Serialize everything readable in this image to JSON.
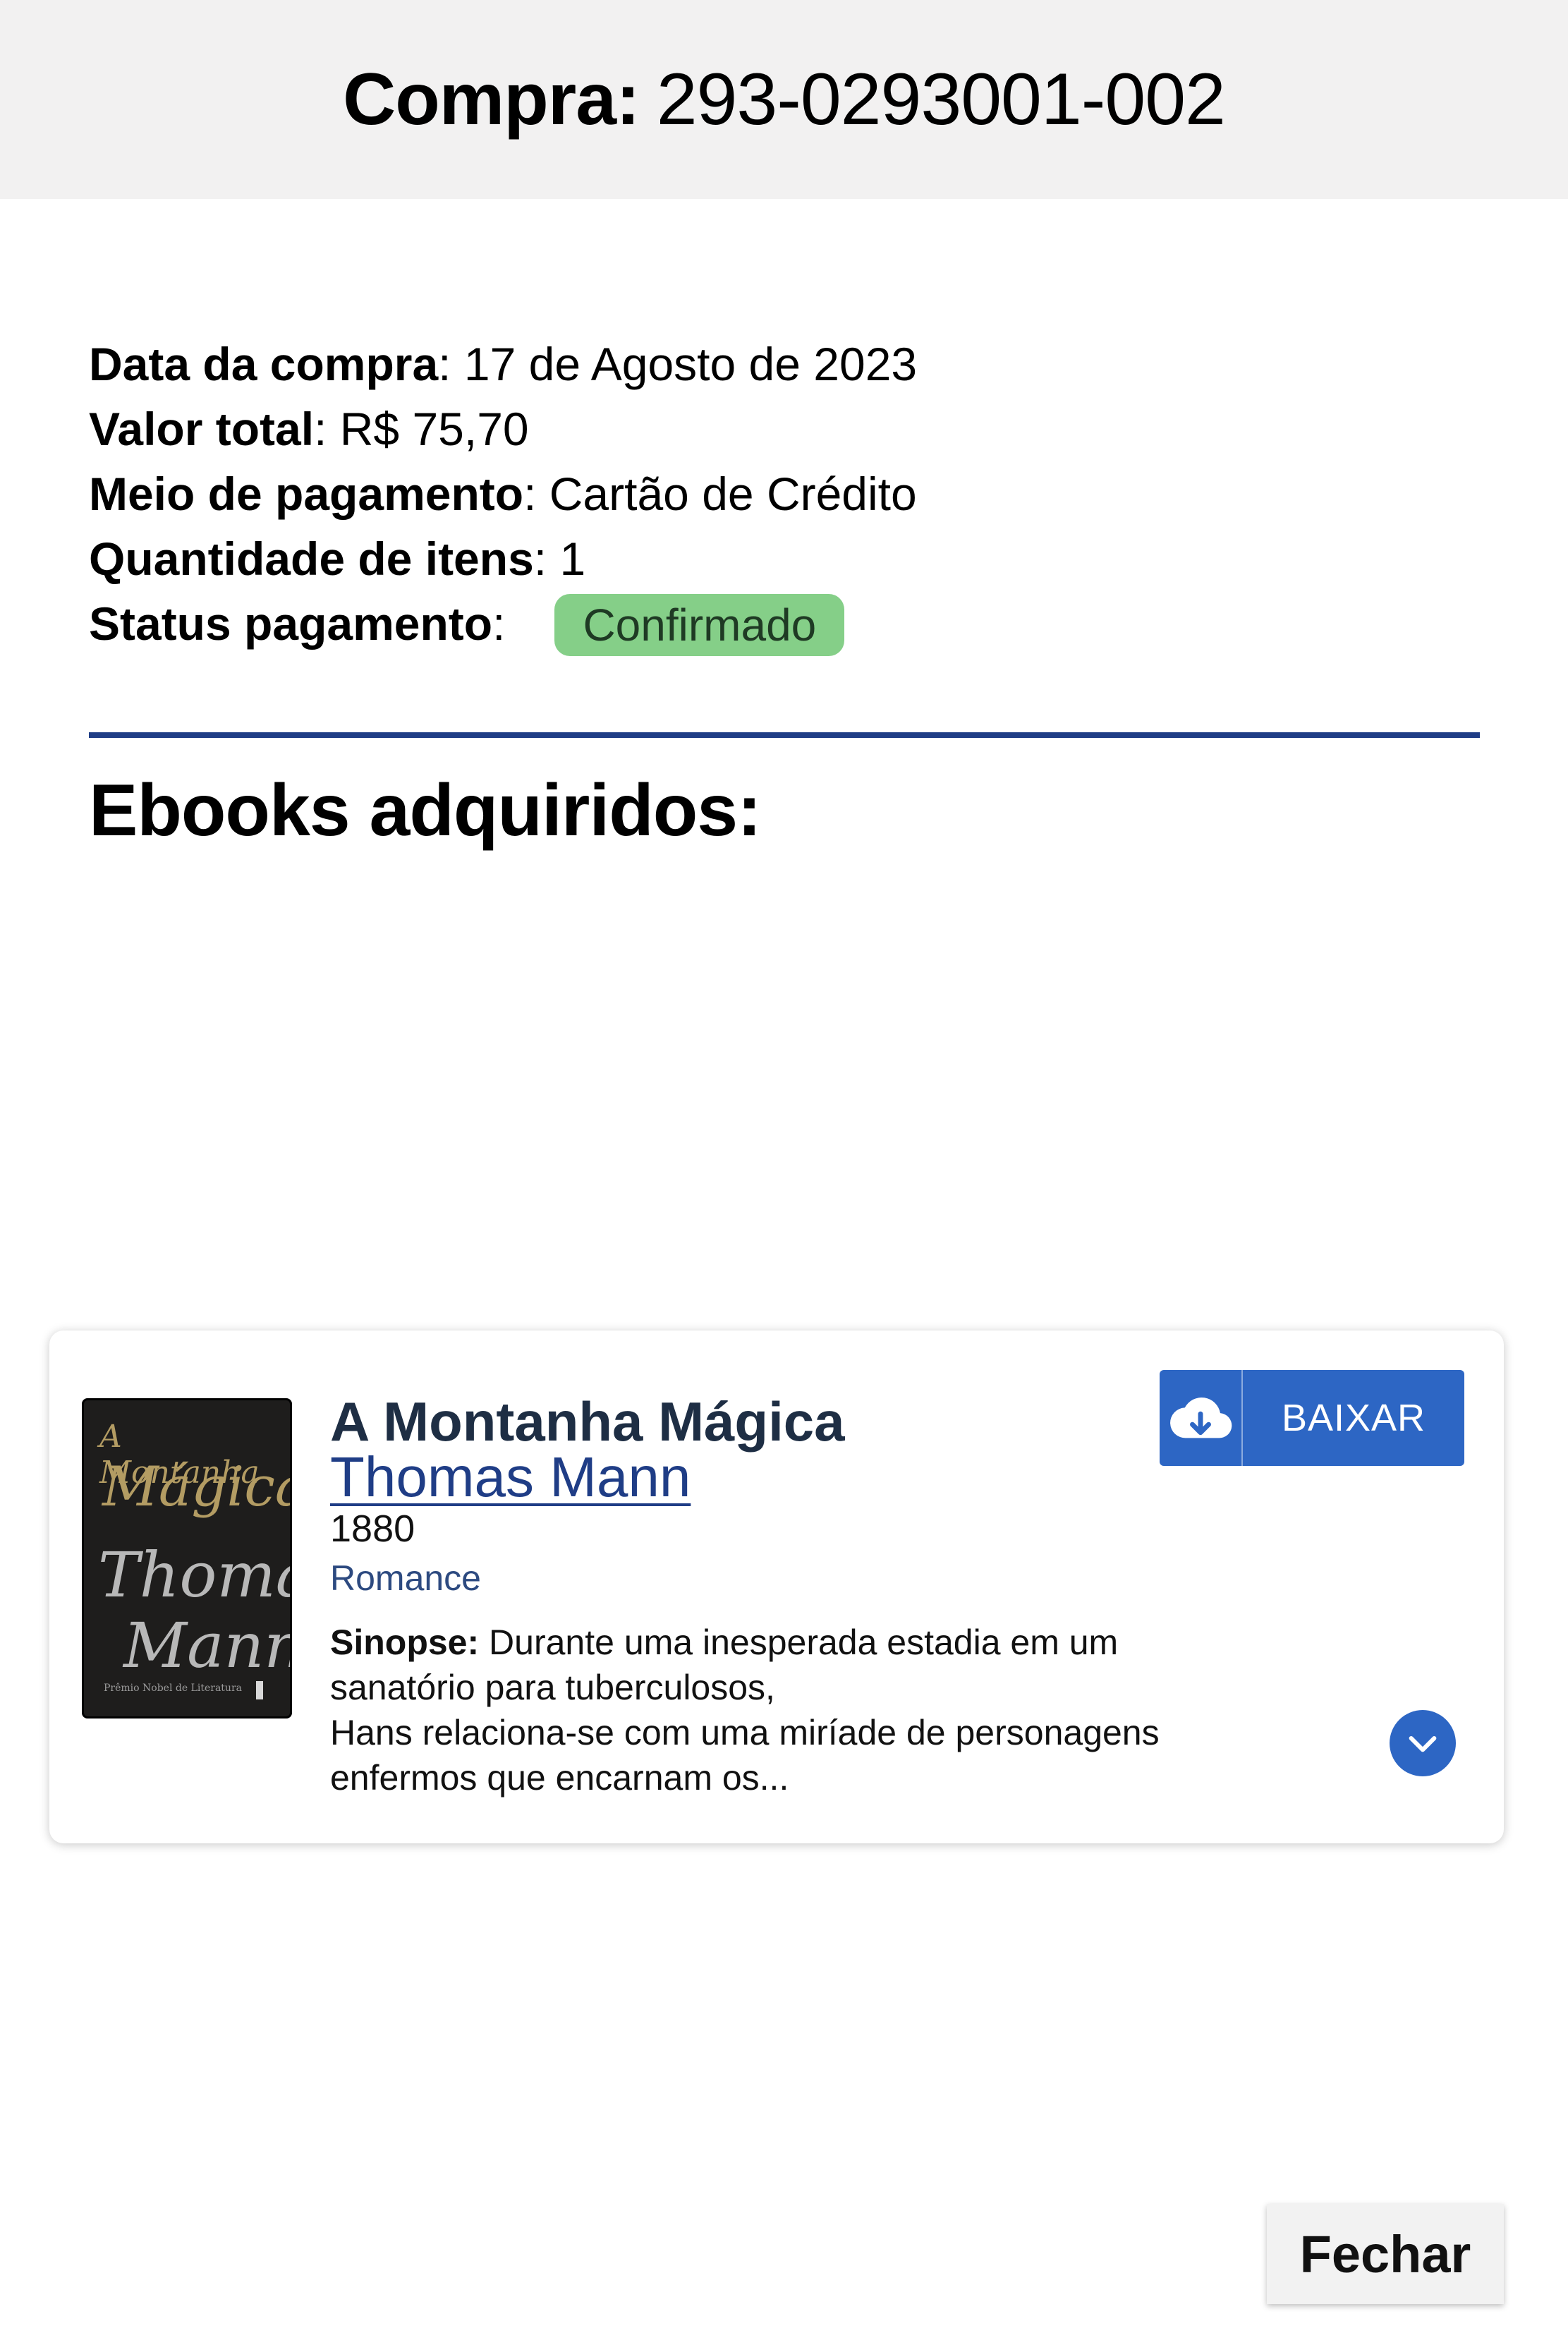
{
  "header": {
    "label": "Compra:",
    "order_number": "293-0293001-002"
  },
  "purchase": {
    "date_label": "Data da compra",
    "date_value": "17 de Agosto de 2023",
    "total_label": "Valor total",
    "total_value": "R$ 75,70",
    "payment_label": "Meio de pagamento",
    "payment_value": "Cartão de Crédito",
    "quantity_label": "Quantidade de itens",
    "quantity_value": "1",
    "status_label": "Status pagamento",
    "status_value": "Confirmado",
    "status_color": "#85cf88"
  },
  "section_title": "Ebooks adquiridos:",
  "book": {
    "title": "A Montanha Mágica",
    "author": "Thomas Mann",
    "year": "1880",
    "genre": "Romance",
    "synopsis_label": "Sinopse:",
    "synopsis_lines": [
      "Durante uma inesperada estadia em um",
      "sanatório para tuberculosos,",
      "Hans relaciona-se com uma miríade de personagens",
      "enfermos que encarnam os..."
    ],
    "cover": {
      "line1": "A Montanha",
      "line2": "Mágica",
      "line3": "Thomas",
      "line4": "Mann",
      "footer": "Prêmio Nobel de Literatura"
    },
    "download_label": "BAIXAR",
    "download_icon": "cloud-download-icon",
    "expand_icon": "chevron-down-icon"
  },
  "close_label": "Fechar",
  "colors": {
    "accent": "#2d66c4",
    "divider": "#1f3d86",
    "header_bg": "#f2f1f1"
  }
}
